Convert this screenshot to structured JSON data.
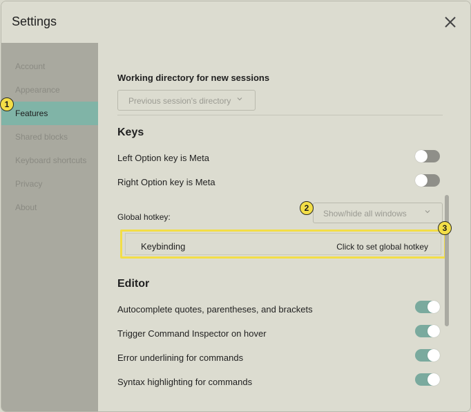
{
  "window": {
    "title": "Settings"
  },
  "sidebar": {
    "items": [
      {
        "label": "Account",
        "active": false
      },
      {
        "label": "Appearance",
        "active": false
      },
      {
        "label": "Features",
        "active": true
      },
      {
        "label": "Shared blocks",
        "active": false
      },
      {
        "label": "Keyboard shortcuts",
        "active": false
      },
      {
        "label": "Privacy",
        "active": false
      },
      {
        "label": "About",
        "active": false
      }
    ]
  },
  "features": {
    "working_directory": {
      "label": "Working directory for new sessions",
      "value": "Previous session's directory"
    },
    "keys": {
      "heading": "Keys",
      "left_option_meta": {
        "label": "Left Option key is Meta",
        "enabled": false
      },
      "right_option_meta": {
        "label": "Right Option key is Meta",
        "enabled": false
      },
      "global_hotkey": {
        "label": "Global hotkey:",
        "value": "Show/hide all windows",
        "keybinding_label": "Keybinding",
        "keybinding_action": "Click to set global hotkey"
      }
    },
    "editor": {
      "heading": "Editor",
      "items": [
        {
          "label": "Autocomplete quotes, parentheses, and brackets",
          "enabled": true
        },
        {
          "label": "Trigger Command Inspector on hover",
          "enabled": true
        },
        {
          "label": "Error underlining for commands",
          "enabled": true
        },
        {
          "label": "Syntax highlighting for commands",
          "enabled": true
        }
      ]
    }
  },
  "annotations": {
    "badge1": "1",
    "badge2": "2",
    "badge3": "3"
  },
  "colors": {
    "accent": "#80b4a7",
    "highlight": "#f3de47",
    "toggle_on": "#7aaa9e",
    "toggle_off": "#8f8f89"
  }
}
